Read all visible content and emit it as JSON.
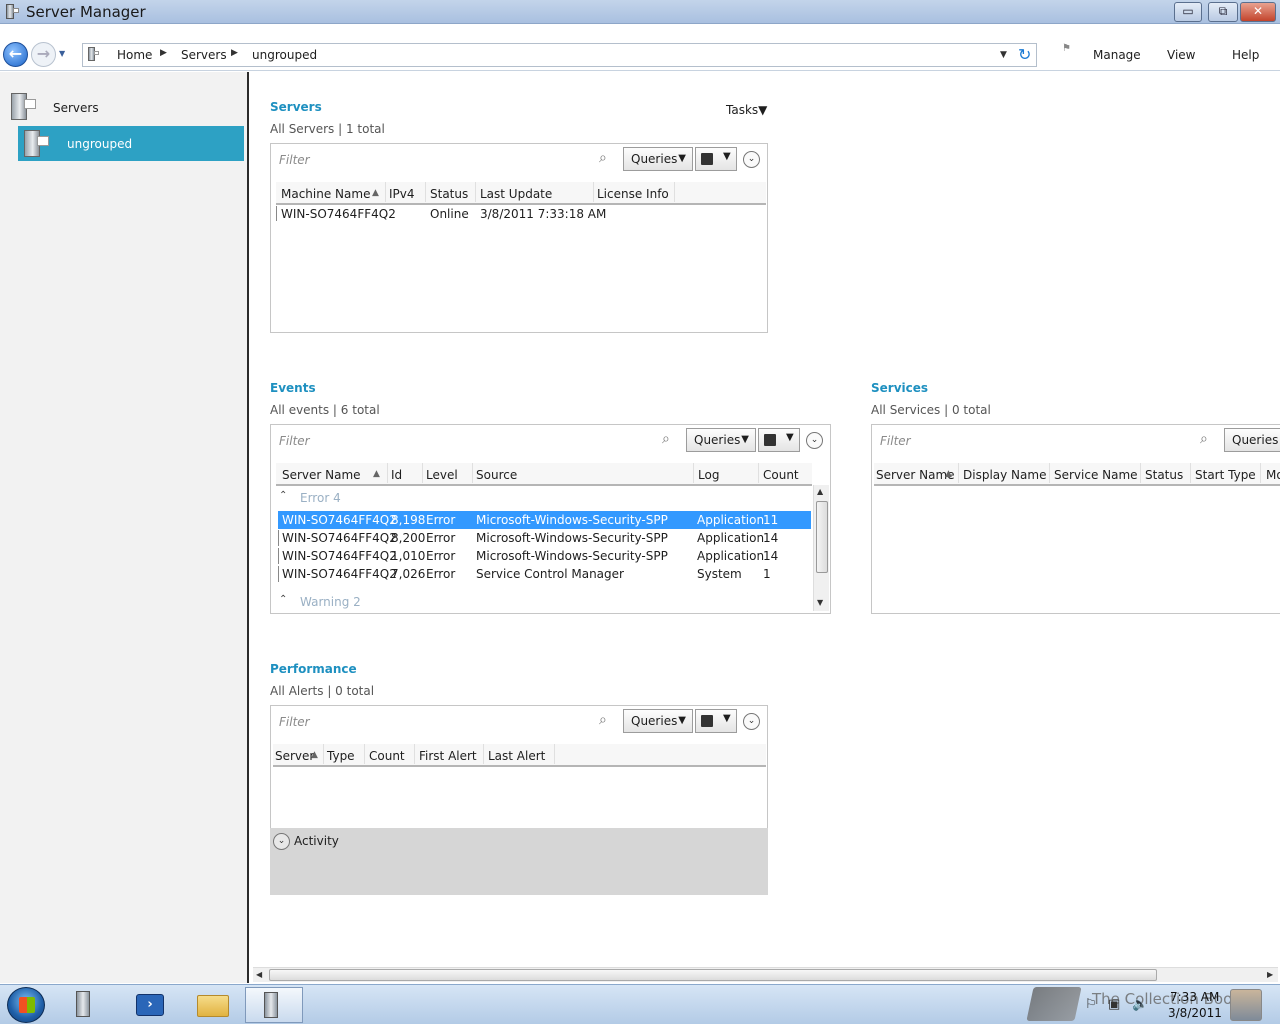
{
  "window": {
    "title": "Server Manager",
    "min_label": "▭",
    "restore_label": "⧉",
    "close_label": "✕"
  },
  "nav": {
    "breadcrumb": [
      "Home",
      "Servers",
      "ungrouped"
    ],
    "menu": [
      "Manage",
      "View",
      "Help"
    ]
  },
  "sidebar": {
    "items": [
      {
        "label": "Servers"
      },
      {
        "label": "ungrouped"
      }
    ]
  },
  "servers": {
    "title": "Servers",
    "subtitle": "All Servers | 1 total",
    "tasks_label": "Tasks▼",
    "filter_placeholder": "Filter",
    "queries_label": "Queries",
    "columns": [
      "Machine Name",
      "IPv4",
      "Status",
      "Last Update",
      "License Info"
    ],
    "rows": [
      [
        "WIN-SO7464FF4Q2",
        "",
        "Online",
        "3/8/2011 7:33:18 AM",
        ""
      ]
    ]
  },
  "events": {
    "title": "Events",
    "subtitle": "All events | 6 total",
    "filter_placeholder": "Filter",
    "queries_label": "Queries",
    "columns": [
      "Server Name",
      "Id",
      "Level",
      "Source",
      "Log",
      "Count"
    ],
    "group_error": "Error 4",
    "group_warning": "Warning 2",
    "rows": [
      [
        "WIN-SO7464FF4Q2",
        "8,198",
        "Error",
        "Microsoft-Windows-Security-SPP",
        "Application",
        "11"
      ],
      [
        "WIN-SO7464FF4Q2",
        "8,200",
        "Error",
        "Microsoft-Windows-Security-SPP",
        "Application",
        "14"
      ],
      [
        "WIN-SO7464FF4Q2",
        "1,010",
        "Error",
        "Microsoft-Windows-Security-SPP",
        "Application",
        "14"
      ],
      [
        "WIN-SO7464FF4Q2",
        "7,026",
        "Error",
        "Service Control Manager",
        "System",
        "1"
      ]
    ]
  },
  "services": {
    "title": "Services",
    "subtitle": "All Services | 0 total",
    "filter_placeholder": "Filter",
    "queries_label": "Queries",
    "columns": [
      "Server Name",
      "Display Name",
      "Service Name",
      "Status",
      "Start Type",
      "Mo"
    ]
  },
  "performance": {
    "title": "Performance",
    "subtitle": "All Alerts | 0 total",
    "filter_placeholder": "Filter",
    "queries_label": "Queries",
    "columns": [
      "Server",
      "Type",
      "Count",
      "First Alert",
      "Last Alert"
    ],
    "activity_label": "Activity"
  },
  "taskbar": {
    "time": "7:33 AM",
    "date": "3/8/2011",
    "watermark": "The Collection Book"
  },
  "colors": {
    "accent": "#1e90c0",
    "selection": "#3399ff",
    "sidebar_selection": "#2da1c4"
  }
}
